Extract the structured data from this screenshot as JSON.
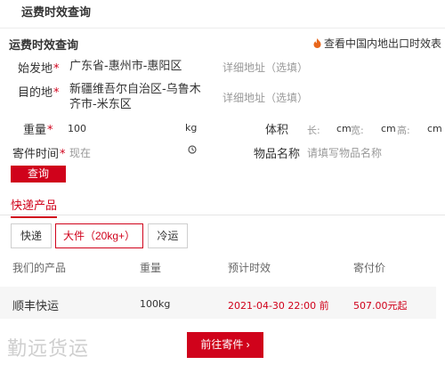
{
  "header": {
    "title": "运费时效查询"
  },
  "section": {
    "title": "运费时效查询",
    "link_label": "查看中国内地出口时效表"
  },
  "form": {
    "origin": {
      "label": "始发地",
      "required": "*",
      "value": "广东省-惠州市-惠阳区",
      "address_placeholder": "详细地址（选填）"
    },
    "destination": {
      "label": "目的地",
      "required": "*",
      "value": "新疆维吾尔自治区-乌鲁木齐市-米东区",
      "address_placeholder": "详细地址（选填）"
    },
    "weight": {
      "label": "重量",
      "required": "*",
      "value": "100",
      "unit": "kg"
    },
    "volume": {
      "label": "体积",
      "length_label": "长:",
      "width_label": "宽:",
      "height_label": "高:",
      "unit": "cm"
    },
    "send_time": {
      "label": "寄件时间",
      "required": "*",
      "value": "现在"
    },
    "goods": {
      "label": "物品名称",
      "placeholder": "请填写物品名称"
    },
    "query_button": "查询"
  },
  "tabs": [
    {
      "label": "快递产品",
      "active": true
    }
  ],
  "product_types": [
    {
      "label": "快递",
      "active": false
    },
    {
      "label": "大件（20kg+）",
      "active": true
    },
    {
      "label": "冷运",
      "active": false
    }
  ],
  "table": {
    "headers": [
      "我们的产品",
      "重量",
      "预计时效",
      "寄付价"
    ],
    "rows": [
      {
        "product": "顺丰快运",
        "weight": "100kg",
        "eta": "2021-04-30 22:00 前",
        "price": "507.00元起"
      }
    ]
  },
  "watermark": "勤远货运",
  "go_button": "前往寄件 ›",
  "colors": {
    "accent": "#d0021b",
    "muted": "#999999",
    "row_bg": "#f6f6f6"
  }
}
